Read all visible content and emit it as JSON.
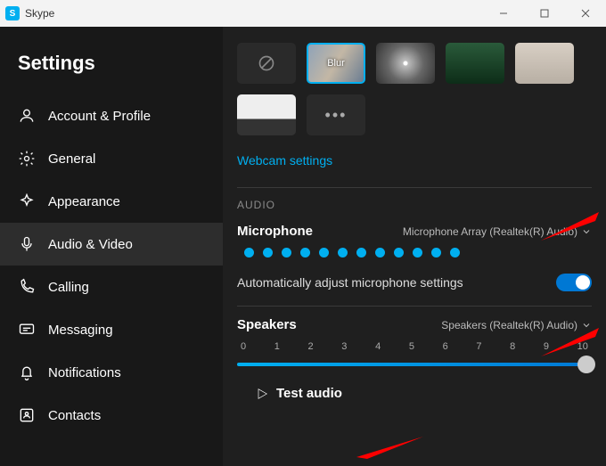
{
  "window": {
    "app_name": "Skype"
  },
  "settings_title": "Settings",
  "sidebar": {
    "items": [
      {
        "label": "Account & Profile"
      },
      {
        "label": "General"
      },
      {
        "label": "Appearance"
      },
      {
        "label": "Audio & Video"
      },
      {
        "label": "Calling"
      },
      {
        "label": "Messaging"
      },
      {
        "label": "Notifications"
      },
      {
        "label": "Contacts"
      }
    ]
  },
  "backgrounds": {
    "blur_label": "Blur",
    "webcam_settings": "Webcam settings"
  },
  "audio": {
    "section_label": "AUDIO",
    "microphone_label": "Microphone",
    "microphone_device": "Microphone Array (Realtek(R) Audio)",
    "auto_adjust_label": "Automatically adjust microphone settings",
    "auto_adjust_on": true,
    "speakers_label": "Speakers",
    "speakers_device": "Speakers (Realtek(R) Audio)",
    "slider_ticks": [
      "0",
      "1",
      "2",
      "3",
      "4",
      "5",
      "6",
      "7",
      "8",
      "9",
      "10"
    ],
    "speaker_value": 10,
    "test_audio_label": "Test audio"
  }
}
